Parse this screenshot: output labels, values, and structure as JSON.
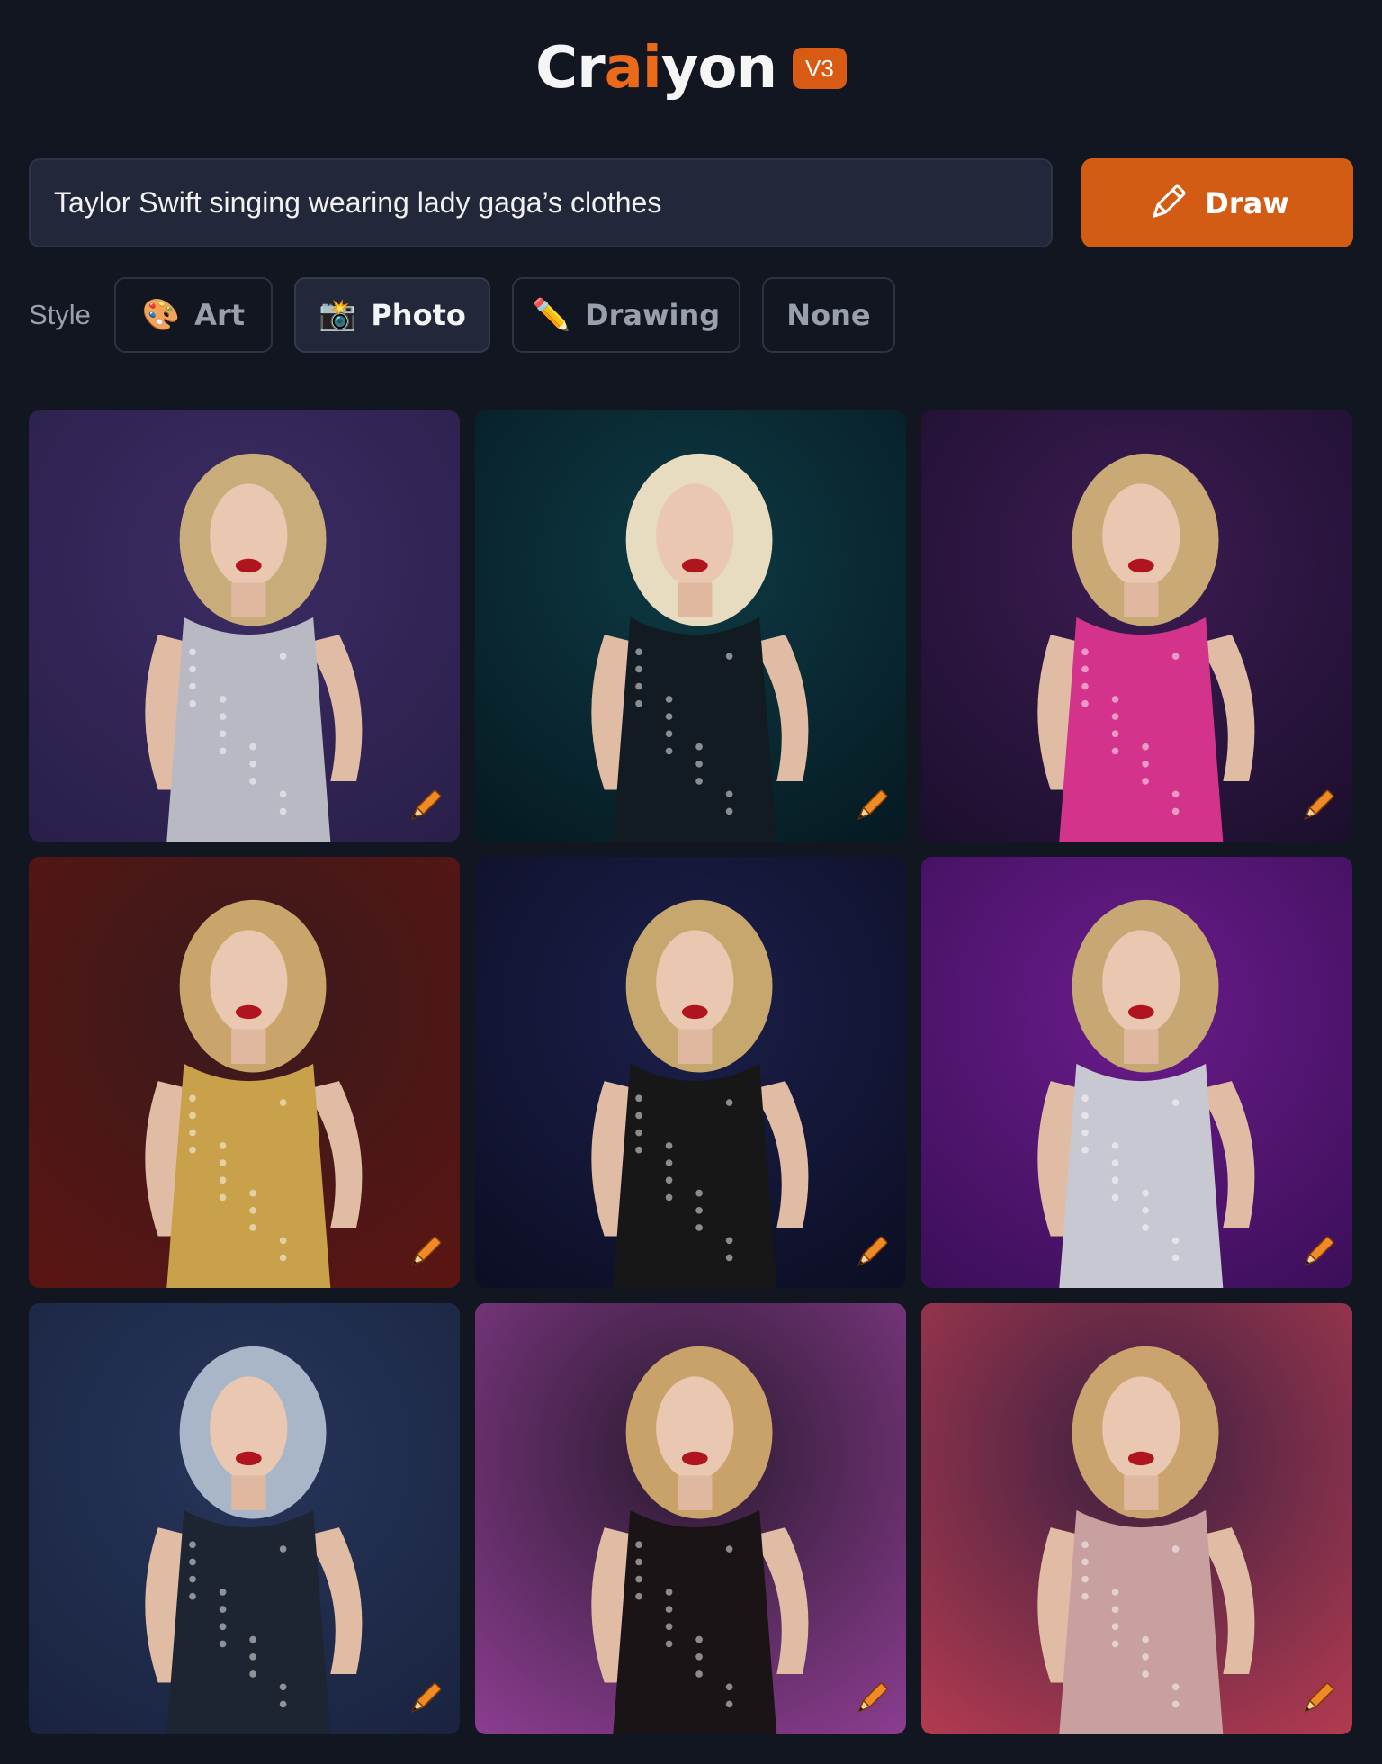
{
  "app": {
    "logo_parts": [
      "Cr",
      "ai",
      "yon"
    ],
    "version": "V3"
  },
  "prompt": {
    "value": "Taylor Swift singing wearing lady gaga’s clothes",
    "draw_label": "Draw"
  },
  "style": {
    "label": "Style",
    "options": [
      {
        "label": "Art",
        "icon": "palette-icon"
      },
      {
        "label": "Photo",
        "icon": "camera-flash-icon"
      },
      {
        "label": "Drawing",
        "icon": "pencil-icon"
      },
      {
        "label": "None"
      }
    ],
    "selected": "Photo"
  },
  "results": [
    {
      "bg": [
        "#3b2c63",
        "#2a1f4a"
      ],
      "outfit": "#b9b9c4",
      "hair": "#c8ad7a"
    },
    {
      "bg": [
        "#0e3a44",
        "#061a22"
      ],
      "outfit": "#121a22",
      "hair": "#e7dcc0"
    },
    {
      "bg": [
        "#3c1c52",
        "#1c0f2e"
      ],
      "outfit": "#d3338a",
      "hair": "#c9a976"
    },
    {
      "bg": [
        "#3a1a1c",
        "#5a1512"
      ],
      "outfit": "#c8a14a",
      "hair": "#c9a56c"
    },
    {
      "bg": [
        "#1c1f4a",
        "#0c0e24"
      ],
      "outfit": "#171717",
      "hair": "#c6a86f"
    },
    {
      "bg": [
        "#6a1c8a",
        "#3c0f5a"
      ],
      "outfit": "#c8c8d2",
      "hair": "#c7a774"
    },
    {
      "bg": [
        "#27355a",
        "#1a2440"
      ],
      "outfit": "#1d2532",
      "hair": "#a9b6c8"
    },
    {
      "bg": [
        "#2a1a30",
        "#8a3c8e"
      ],
      "outfit": "#1a1416",
      "hair": "#c9a26a"
    },
    {
      "bg": [
        "#3c2040",
        "#b03a50"
      ],
      "outfit": "#c9a0a0",
      "hair": "#caa36f"
    }
  ],
  "colors": {
    "background": "#121620",
    "accent": "#d35c14",
    "input_bg": "#222839"
  }
}
